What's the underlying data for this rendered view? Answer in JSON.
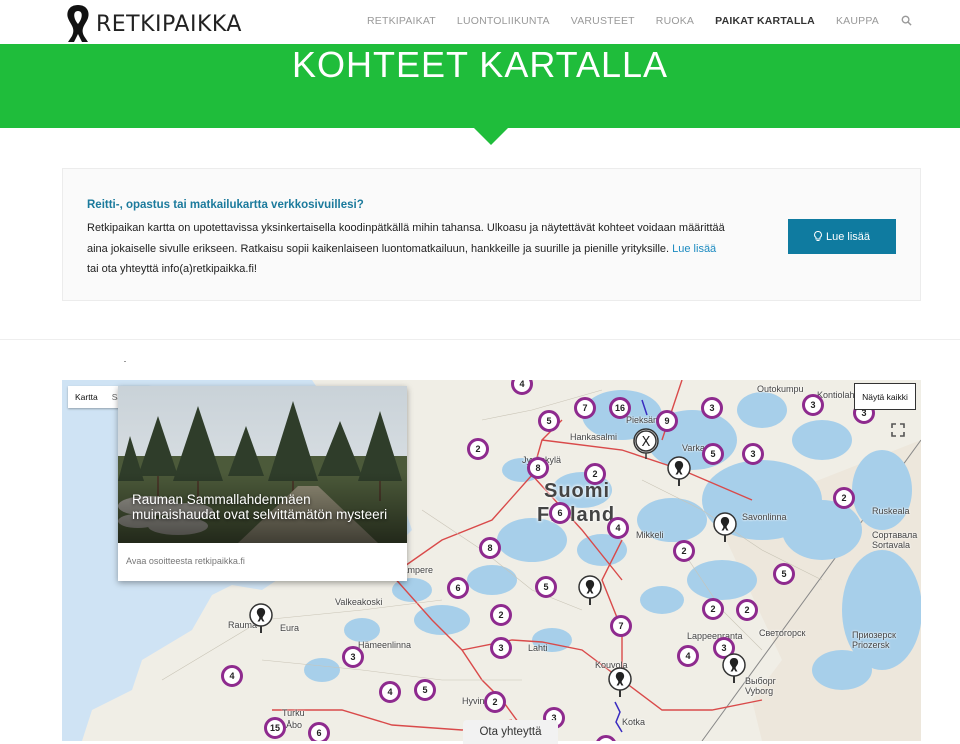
{
  "header": {
    "logo_text": "RETKIPAIKKA",
    "nav": [
      "RETKIPAIKAT",
      "LUONTOLIIKUNTA",
      "VARUSTEET",
      "RUOKA",
      "PAIKAT KARTALLA",
      "KAUPPA"
    ],
    "active_nav": "PAIKAT KARTALLA",
    "search_icon": "search-icon"
  },
  "banner": {
    "title": "KOHTEET KARTALLA",
    "color": "#1fbd3b"
  },
  "info": {
    "title": "Reitti-, opastus tai matkailukartta verkkosivuillesi?",
    "text_1": "Retkipaikan kartta on upotettavissa yksinkertaisella koodinpätkällä mihin tahansa. Ulkoasu ja näytettävät kohteet voidaan määrittää aina jokaiselle sivulle erikseen.  Ratkaisu sopii kaikenlaiseen luontomatkailuun, hankkeille ja suurille ja pienille yrityksille.",
    "link": "Lue lisää",
    "text_2": "tai ota yhteyttä info(a)retkipaikka.fi!",
    "button": "Lue lisää",
    "button_color": "#0f7ba0"
  },
  "map": {
    "type_buttons": [
      "Kartta",
      "Satelliitti"
    ],
    "show_all": "Näytä kaikki",
    "country_label": [
      "Suomi",
      "Finland"
    ],
    "place_labels": [
      "Jyväskylä",
      "Hankasalmi",
      "Mikkeli",
      "Savonlinna",
      "Valkeakoski",
      "Hämeenlinna",
      "Lahti",
      "Kouvola",
      "Kotka",
      "Lappeenranta",
      "Светогорск",
      "Выборг",
      "Vyborg",
      "Turku",
      "Åbo",
      "Hyvinkää",
      "Rauma",
      "Eura",
      "Tampere",
      "Varkaus",
      "Outokumpu",
      "Kontiolahti",
      "Ruskeala",
      "Сортавала",
      "Sortavala",
      "Приозерск",
      "Priozersk",
      "Pieksämäki"
    ],
    "clusters": [
      "4",
      "7",
      "16",
      "5",
      "9",
      "3",
      "2",
      "8",
      "2",
      "3",
      "2",
      "6",
      "4",
      "8",
      "2",
      "5",
      "6",
      "7",
      "2",
      "2",
      "2",
      "5",
      "3",
      "4",
      "3",
      "5",
      "4",
      "3",
      "3",
      "15",
      "6",
      "3",
      "6",
      "2",
      "2",
      "3"
    ],
    "popup": {
      "title": "Rauman Sammallahdenmäen muinaishaudat ovat selvittämätön mysteeri",
      "link": "Avaa osoitteesta retkipaikka.fi"
    }
  },
  "contact_button": "Ota yhteyttä"
}
